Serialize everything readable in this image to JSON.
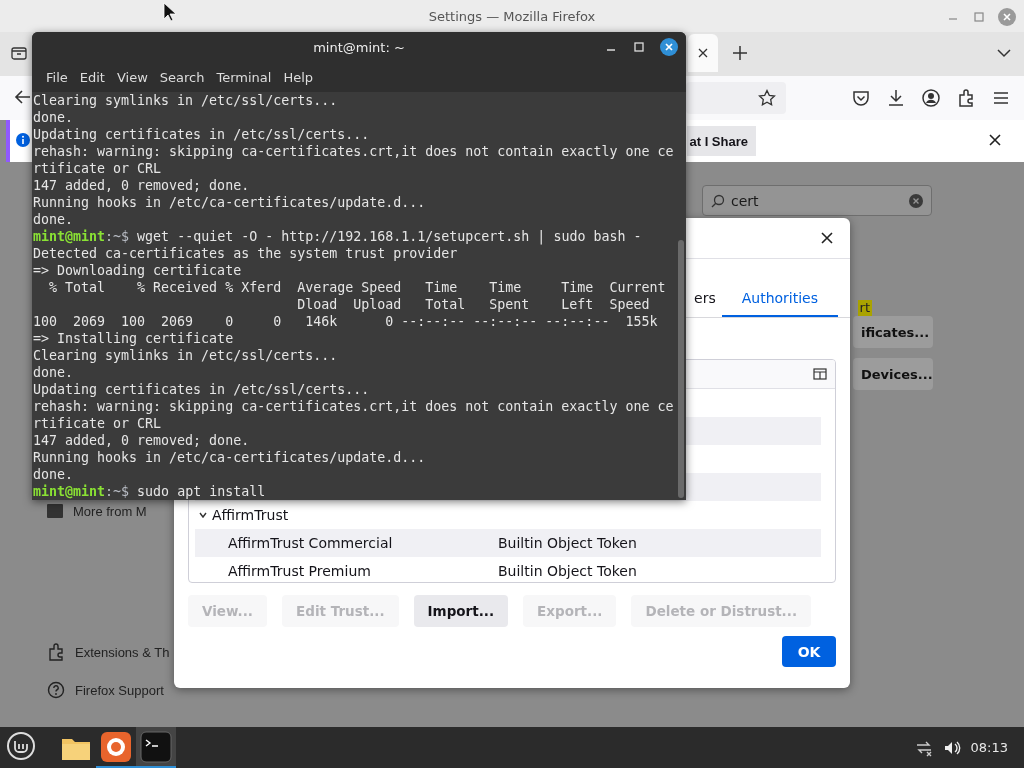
{
  "firefox": {
    "title": "Settings — Mozilla Firefox",
    "notification": {
      "button": "at I Share"
    },
    "search": {
      "value": "cert"
    },
    "page": {
      "highlight": "rt",
      "buttons": [
        "ificates...",
        "Devices..."
      ]
    },
    "sidebar": [
      {
        "kind": "more",
        "label": "More from M"
      },
      {
        "kind": "extensions",
        "label": "Extensions & Th"
      },
      {
        "kind": "support",
        "label": "Firefox Support"
      }
    ]
  },
  "dialog": {
    "tabs": [
      {
        "label": "ers",
        "selected": false
      },
      {
        "label": "Authorities",
        "selected": true
      }
    ],
    "rows": [
      {
        "kind": "covered"
      },
      {
        "kind": "covered"
      },
      {
        "kind": "covered"
      },
      {
        "kind": "covered"
      },
      {
        "kind": "group",
        "name": "AffirmTrust",
        "expanded": true,
        "children": [
          {
            "name": "AffirmTrust Commercial",
            "device": "Builtin Object Token"
          },
          {
            "name": "AffirmTrust Premium",
            "device": "Builtin Object Token"
          }
        ]
      }
    ],
    "buttons": [
      {
        "label": "View...",
        "disabled": true
      },
      {
        "label": "Edit Trust...",
        "disabled": true
      },
      {
        "label": "Import...",
        "disabled": false
      },
      {
        "label": "Export...",
        "disabled": true
      },
      {
        "label": "Delete or Distrust...",
        "disabled": true
      }
    ],
    "ok": "OK"
  },
  "terminal": {
    "title": "mint@mint: ~",
    "menu": [
      "File",
      "Edit",
      "View",
      "Search",
      "Terminal",
      "Help"
    ],
    "lines": [
      {
        "kind": "output",
        "text": "Clearing symlinks in /etc/ssl/certs..."
      },
      {
        "kind": "output",
        "text": "done."
      },
      {
        "kind": "output",
        "text": "Updating certificates in /etc/ssl/certs..."
      },
      {
        "kind": "output",
        "text": "rehash: warning: skipping ca-certificates.crt,it does not contain exactly one ce"
      },
      {
        "kind": "output",
        "text": "rtificate or CRL"
      },
      {
        "kind": "output",
        "text": "147 added, 0 removed; done."
      },
      {
        "kind": "output",
        "text": "Running hooks in /etc/ca-certificates/update.d..."
      },
      {
        "kind": "output",
        "text": "done."
      },
      {
        "kind": "prompt",
        "user": "mint@mint",
        "path": ":~$",
        "command": " wget --quiet -O - http://192.168.1.1/setupcert.sh | sudo bash -"
      },
      {
        "kind": "output",
        "text": "Detected ca-certificates as the system trust provider"
      },
      {
        "kind": "output",
        "text": "=> Downloading certificate"
      },
      {
        "kind": "output",
        "text": "  % Total    % Received % Xferd  Average Speed   Time    Time     Time  Current"
      },
      {
        "kind": "output",
        "text": "                                 Dload  Upload   Total   Spent    Left  Speed"
      },
      {
        "kind": "output",
        "text": "100  2069  100  2069    0     0   146k      0 --:--:-- --:--:-- --:--:--  155k"
      },
      {
        "kind": "output",
        "text": "=> Installing certificate"
      },
      {
        "kind": "output",
        "text": "Clearing symlinks in /etc/ssl/certs..."
      },
      {
        "kind": "output",
        "text": "done."
      },
      {
        "kind": "output",
        "text": "Updating certificates in /etc/ssl/certs..."
      },
      {
        "kind": "output",
        "text": "rehash: warning: skipping ca-certificates.crt,it does not contain exactly one ce"
      },
      {
        "kind": "output",
        "text": "rtificate or CRL"
      },
      {
        "kind": "output",
        "text": "147 added, 0 removed; done."
      },
      {
        "kind": "output",
        "text": "Running hooks in /etc/ca-certificates/update.d..."
      },
      {
        "kind": "output",
        "text": "done."
      },
      {
        "kind": "prompt",
        "user": "mint@mint",
        "path": ":~$",
        "command": " sudo apt install"
      }
    ]
  },
  "taskbar": {
    "apps": [
      {
        "kind": "files",
        "running": false,
        "selected": false
      },
      {
        "kind": "firefox",
        "running": true,
        "selected": false
      },
      {
        "kind": "terminal",
        "running": true,
        "selected": true
      }
    ],
    "clock": "08:13"
  }
}
